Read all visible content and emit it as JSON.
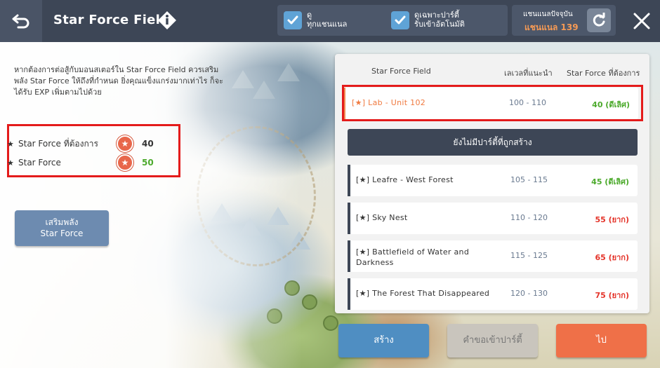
{
  "header": {
    "title": "Star Force Field",
    "check_all": "ดู\nทุกแชนแนล",
    "check_auto_party": "ดูเฉพาะปาร์ตี้\nรับเข้าอัตโนมัติ",
    "channel_caption": "แชนแนลปัจจุบัน",
    "channel_value": "แชนแนล 139"
  },
  "info": {
    "description": "หากต้องการต่อสู้กับมอนสเตอร์ใน Star Force Field ควรเสริมพลัง Star Force ให้ถึงที่กำหนด ยิ่งคุณแข็งแกร่งมากเท่าไร ก็จะได้รับ EXP เพิ่มตามไปด้วย",
    "required_label": "Star Force ที่ต้องการ",
    "required_value": "40",
    "current_label": "Star Force",
    "current_value": "50",
    "enhance_button": "เสริมพลัง\nStar Force"
  },
  "table": {
    "headers": [
      "Star Force Field",
      "เลเวลที่แนะนำ",
      "Star Force ที่ต้องการ"
    ],
    "no_party_text": "ยังไม่มีปาร์ตี้ที่ถูกสร้าง",
    "rows": [
      {
        "name": "[★]  Lab - Unit 102",
        "level": "100 - 110",
        "req": "40 (ดีเลิศ)"
      },
      {
        "name": "[★]  Leafre - West Forest",
        "level": "105 - 115",
        "req": "45 (ดีเลิศ)"
      },
      {
        "name": "[★]  Sky Nest",
        "level": "110 - 120",
        "req": "55 (ยาก)"
      },
      {
        "name": "[★]  Battlefield of Water and Darkness",
        "level": "115 - 125",
        "req": "65 (ยาก)"
      },
      {
        "name": "[★]  The Forest That Disappeared",
        "level": "120 - 130",
        "req": "75 (ยาก)"
      }
    ]
  },
  "buttons": {
    "create": "สร้าง",
    "request": "คำขอเข้าปาร์ตี้",
    "go": "ไป"
  },
  "colors": {
    "topbar": "#3d4656",
    "accent_orange": "#ef7048",
    "accent_blue": "#4f8ec2",
    "highlight_red": "#e41b1b",
    "good_green": "#4caa2c",
    "hard_red": "#e4342a"
  }
}
